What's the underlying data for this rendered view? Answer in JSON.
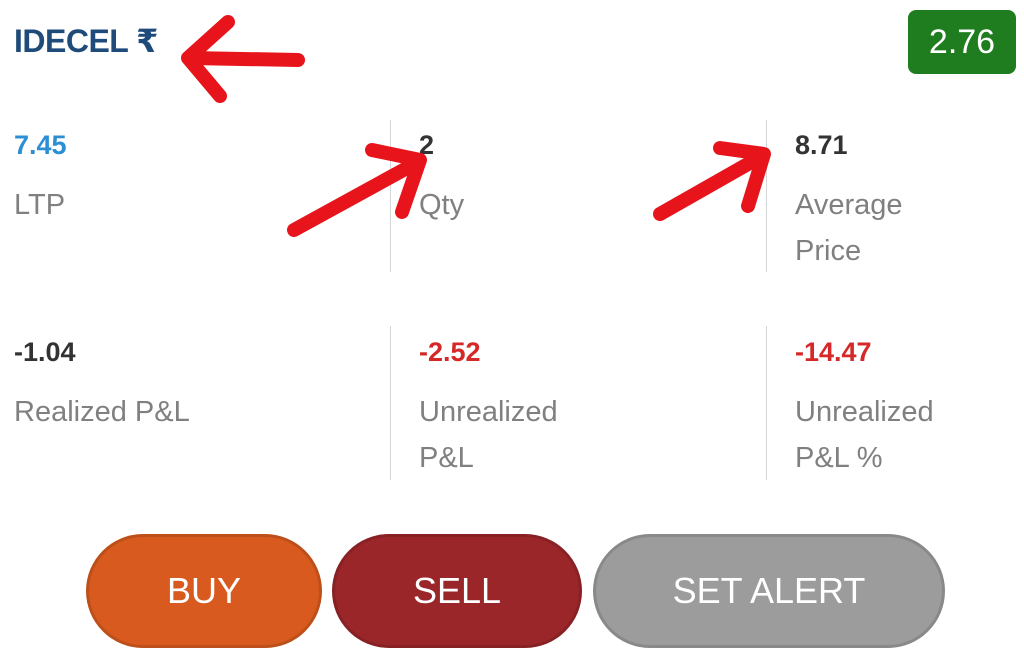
{
  "header": {
    "symbol": "IDECEL ₹",
    "change_badge": "2.76"
  },
  "stats": {
    "ltp": {
      "value": "7.45",
      "label": "LTP"
    },
    "qty": {
      "value": "2",
      "label": "Qty"
    },
    "avg_price": {
      "value": "8.71",
      "label": "Average Price"
    },
    "realized_pl": {
      "value": "-1.04",
      "label": "Realized P&L"
    },
    "unrealized_pl": {
      "value": "-2.52",
      "label": "Unrealized P&L"
    },
    "unrealized_pl_pct": {
      "value": "-14.47",
      "label": "Unrealized P&L %"
    }
  },
  "actions": {
    "buy": "BUY",
    "sell": "SELL",
    "set_alert": "SET ALERT"
  },
  "colors": {
    "symbol": "#1e4b7a",
    "badge": "#1f7d1f",
    "ltp_value": "#2c8fd6",
    "negative": "#d62828",
    "buy": "#d85a1e",
    "sell": "#9a262a",
    "set_alert": "#9c9c9c",
    "annotation_arrow": "#e8141b"
  }
}
